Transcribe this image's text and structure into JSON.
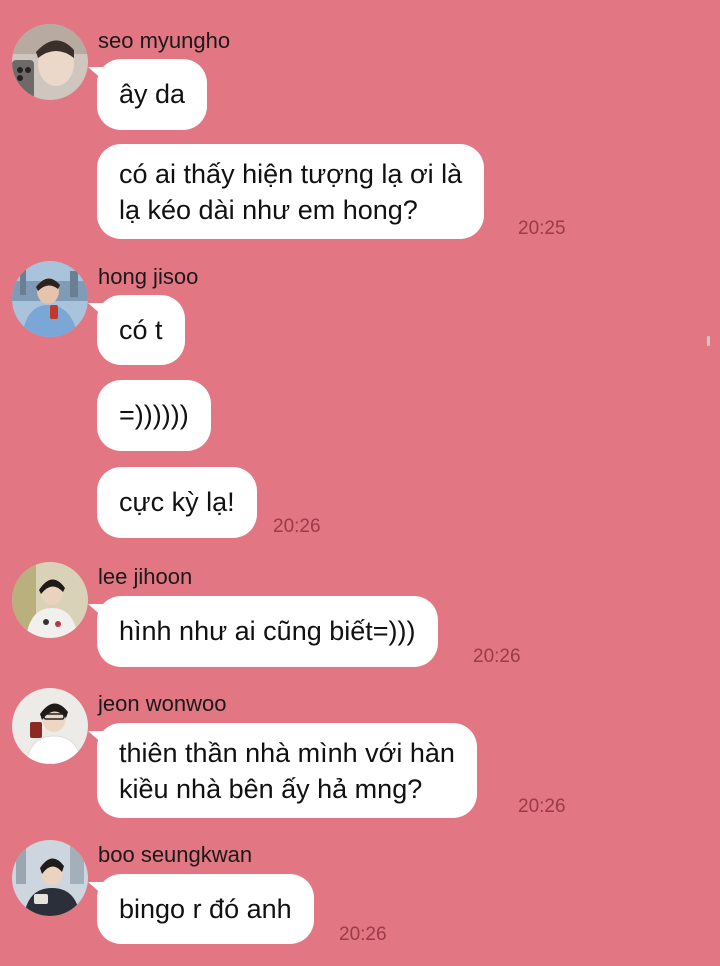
{
  "conversation": [
    {
      "sender": "seo myungho",
      "avatar_icon": "profile-photo-icon",
      "messages": [
        "ây da",
        "có ai thấy hiện tượng lạ ơi là\nlạ kéo dài như em hong?"
      ],
      "time": "20:25"
    },
    {
      "sender": "hong jisoo",
      "avatar_icon": "profile-photo-icon",
      "messages": [
        "có t",
        "=))))))",
        "cực kỳ lạ!"
      ],
      "time": "20:26"
    },
    {
      "sender": "lee jihoon",
      "avatar_icon": "profile-photo-icon",
      "messages": [
        "hình như ai cũng biết=)))"
      ],
      "time": "20:26"
    },
    {
      "sender": "jeon wonwoo",
      "avatar_icon": "profile-photo-icon",
      "messages": [
        "thiên thần nhà mình với hàn\nkiều nhà bên ấy hả mng?"
      ],
      "time": "20:26"
    },
    {
      "sender": "boo seungkwan",
      "avatar_icon": "profile-photo-icon",
      "messages": [
        "bingo r đó anh"
      ],
      "time": "20:26"
    }
  ],
  "colors": {
    "background": "#e27683",
    "bubble": "#ffffff",
    "timestamp": "#9a3b47"
  }
}
